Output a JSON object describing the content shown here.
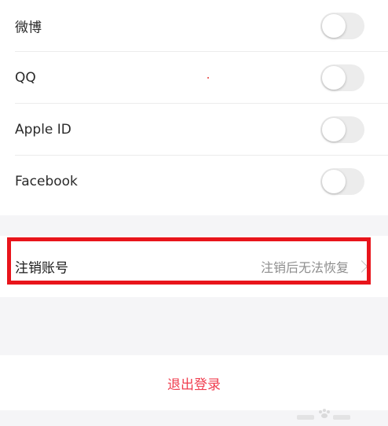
{
  "bindings": [
    {
      "label": "微博",
      "enabled": false
    },
    {
      "label": "QQ",
      "enabled": false
    },
    {
      "label": "Apple ID",
      "enabled": false
    },
    {
      "label": "Facebook",
      "enabled": false
    }
  ],
  "account": {
    "label": "注销账号",
    "hint": "注销后无法恢复"
  },
  "logout": {
    "label": "退出登录"
  },
  "colors": {
    "highlight": "#e8141b",
    "logout_text": "#f03e4f",
    "toggle_off": "#ececec",
    "background": "#f5f5f7"
  },
  "icons": {
    "chevron": "chevron-right-icon",
    "watermark": "baidu-jingyan-watermark"
  }
}
